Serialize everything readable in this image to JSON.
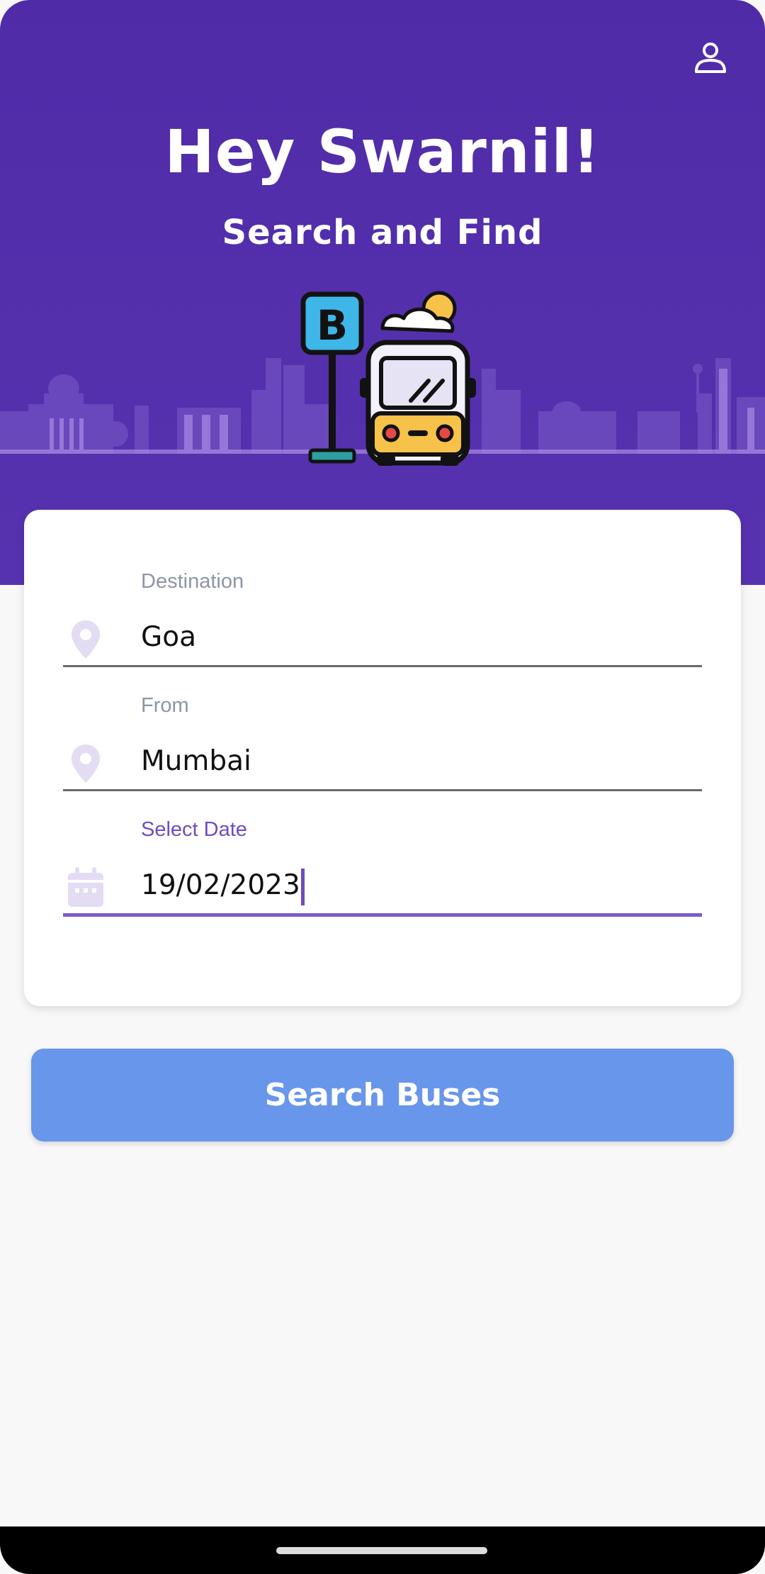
{
  "header": {
    "greeting": "Hey Swarnil!",
    "subtitle": "Search and Find",
    "profile_icon": "user-icon",
    "bus_stop_sign": "B"
  },
  "form": {
    "destination": {
      "label": "Destination",
      "value": "Goa",
      "icon": "location-pin-icon"
    },
    "from": {
      "label": "From",
      "value": "Mumbai",
      "icon": "location-pin-icon"
    },
    "date": {
      "label": "Select Date",
      "value": "19/02/2023",
      "icon": "calendar-icon"
    }
  },
  "search_button": {
    "label": "Search Buses"
  },
  "colors": {
    "header_bg": "#5230ad",
    "accent": "#6e4dbf",
    "button_bg": "#6896ea",
    "icon_tint": "#e3dcf3"
  }
}
